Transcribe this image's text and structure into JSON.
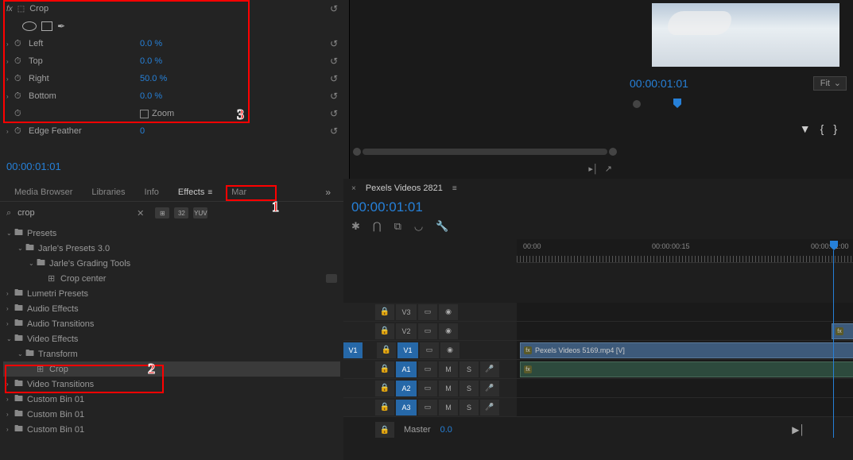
{
  "effect_controls": {
    "effect_name": "Crop",
    "fx_label": "fx",
    "params": {
      "left": {
        "label": "Left",
        "value": "0.0 %"
      },
      "top": {
        "label": "Top",
        "value": "0.0 %"
      },
      "right": {
        "label": "Right",
        "value": "50.0 %"
      },
      "bottom": {
        "label": "Bottom",
        "value": "0.0 %"
      },
      "zoom": {
        "label": "Zoom"
      },
      "edge_feather": {
        "label": "Edge Feather",
        "value": "0"
      }
    },
    "timecode": "00:00:01:01"
  },
  "program_monitor": {
    "timecode": "00:00:01:01",
    "fit_label": "Fit"
  },
  "project_panel": {
    "tabs": {
      "media_browser": "Media Browser",
      "libraries": "Libraries",
      "info": "Info",
      "effects": "Effects",
      "markers": "Mar"
    },
    "search_value": "crop",
    "badge_32": "32",
    "badge_yuv": "YUV",
    "tree": {
      "presets": "Presets",
      "jarles_presets": "Jarle's Presets 3.0",
      "jarles_grading": "Jarle's Grading Tools",
      "crop_center": "Crop center",
      "lumetri_presets": "Lumetri Presets",
      "audio_effects": "Audio Effects",
      "audio_transitions": "Audio Transitions",
      "video_effects": "Video Effects",
      "transform": "Transform",
      "crop": "Crop",
      "video_transitions": "Video Transitions",
      "custom_bin_01a": "Custom Bin 01",
      "custom_bin_01b": "Custom Bin 01",
      "custom_bin_01c": "Custom Bin 01"
    }
  },
  "timeline": {
    "sequence_name": "Pexels Videos 2821",
    "timecode": "00:00:01:01",
    "ruler": {
      "t0": "00:00",
      "t1": "00:00:00:15",
      "t2": "00:00:01:00"
    },
    "tracks": {
      "v3": "V3",
      "v2": "V2",
      "v1": "V1",
      "a1": "A1",
      "a2": "A2",
      "a3": "A3"
    },
    "clip_name": "Pexels Videos 5169.mp4 [V]",
    "master_label": "Master",
    "master_value": "0.0",
    "mute": "M",
    "solo": "S"
  },
  "annotations": {
    "a1": "1",
    "a2": "2",
    "a3": "3"
  }
}
